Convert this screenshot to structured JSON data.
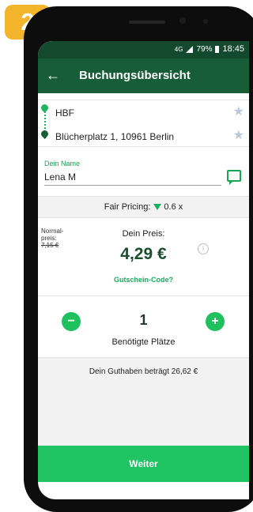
{
  "step_badge": "2",
  "status_bar": {
    "network": "4G",
    "battery": "79%",
    "time": "18:45"
  },
  "app_bar": {
    "title": "Buchungsübersicht"
  },
  "route": {
    "from": "HBF",
    "to": "Blücherplatz 1, 10961 Berlin"
  },
  "name_field": {
    "label": "Dein Name",
    "value": "Lena M"
  },
  "fair_pricing": {
    "label": "Fair Pricing:",
    "value": "0.6 x"
  },
  "pricing": {
    "normal_label": "Normal-\npreis:",
    "normal_value": "7,15 €",
    "price_label": "Dein Preis:",
    "price_value": "4,29 €",
    "coupon": "Gutschein-Code?"
  },
  "seats": {
    "count": "1",
    "label": "Benötigte Plätze"
  },
  "balance": {
    "text": "Dein Guthaben beträgt 26,62 €"
  },
  "footer": {
    "button": "Weiter"
  },
  "colors": {
    "appbar": "#175e38",
    "statusbar": "#134a2e",
    "accent_green": "#20c463",
    "badge": "#f4b42b",
    "star": "#b8c9d9"
  }
}
